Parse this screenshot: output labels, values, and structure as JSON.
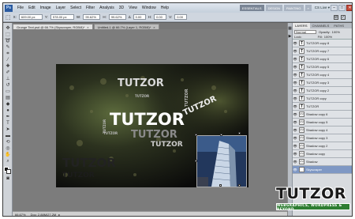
{
  "app": {
    "logo": "Ps",
    "menu": [
      "File",
      "Edit",
      "Image",
      "Layer",
      "Select",
      "Filter",
      "Analysis",
      "3D",
      "View",
      "Window",
      "Help"
    ],
    "workspaces": [
      "ESSENTIALS",
      "DESIGN",
      "PAINTING"
    ],
    "workspace_more": "»",
    "cs_live": "CS Live ▾",
    "window_controls": [
      "–",
      "□",
      "✕"
    ]
  },
  "options": {
    "x": "609.00 px",
    "y": "578.00 px",
    "w": "99.62%",
    "h": "99.62%",
    "angle": "0.00",
    "h_skew": "0.00",
    "v_skew": "0.00",
    "label_x": "X:",
    "label_y": "Y:",
    "label_w": "W:",
    "label_h": "H:",
    "label_angle": "∆",
    "label_hskew": "H:",
    "label_vskew": "V:",
    "cancel": "⊘",
    "commit": "✓"
  },
  "tabs": [
    {
      "label": "Grunge Text.psd @ 66.7% (Skyscraper, RGB/8)*",
      "active": true
    },
    {
      "label": "Untitled-1 @ 66.7% (Layer 1, RGB/8)*",
      "active": false
    }
  ],
  "canvas_text": {
    "main": "TUTZOR",
    "words": [
      "TUTZOR",
      "TUTZOR",
      "TUTZOR",
      "TUTZOR",
      "TUTZOR",
      "TUTZOR",
      "TUTZOR",
      "TUTZOR",
      "TUTZOR",
      "TUTZOR"
    ]
  },
  "status": {
    "zoom": "66.67%",
    "doc": "Doc: 2.88M/27.2M"
  },
  "layers_panel": {
    "tabs": [
      "LAYERS",
      "CHANNELS",
      "PATHS"
    ],
    "blend_mode": "Normal",
    "opacity_label": "Opacity:",
    "opacity_value": "100%",
    "lock_label": "Lock:",
    "fill_label": "Fill:",
    "fill_value": "100%",
    "rows": [
      {
        "name": "TUTZOR copy 8",
        "kind": "T"
      },
      {
        "name": "TUTZOR copy 7",
        "kind": "T"
      },
      {
        "name": "TUTZOR copy 6",
        "kind": "T"
      },
      {
        "name": "TUTZOR copy 5",
        "kind": "T"
      },
      {
        "name": "TUTZOR copy 4",
        "kind": "T"
      },
      {
        "name": "TUTZOR copy 3",
        "kind": "T"
      },
      {
        "name": "TUTZOR copy 2",
        "kind": "T"
      },
      {
        "name": "TUTZOR copy",
        "kind": "T"
      },
      {
        "name": "TUTZOR",
        "kind": "T"
      },
      {
        "name": "Shadow copy 6",
        "kind": "S"
      },
      {
        "name": "Shadow copy 5",
        "kind": "S"
      },
      {
        "name": "Shadow copy 4",
        "kind": "S"
      },
      {
        "name": "Shadow copy 3",
        "kind": "S"
      },
      {
        "name": "Shadow copy 2",
        "kind": "S"
      },
      {
        "name": "Shadow copy",
        "kind": "S"
      },
      {
        "name": "Shadow",
        "kind": "S"
      },
      {
        "name": "Skyscraper",
        "kind": "I"
      }
    ]
  },
  "watermark": {
    "title": "TUTZOR",
    "tagline": "WEBGRAPHICS, WORDPRESS & BEYOND"
  },
  "colors": {
    "canvas": "#0c0c0c",
    "workspace": "#7c7c7c",
    "selected_layer": "#7f98c4",
    "watermark_bar": "#2e7d32"
  }
}
